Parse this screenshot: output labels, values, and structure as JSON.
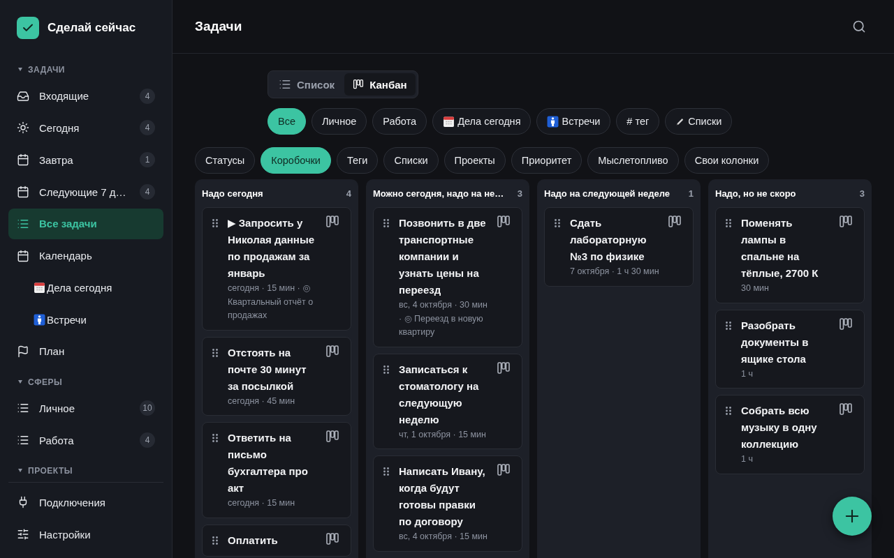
{
  "app": {
    "name": "Сделай сейчас"
  },
  "sidebar": {
    "sections": [
      {
        "title": "ЗАДАЧИ",
        "expanded": true,
        "items": [
          {
            "label": "Входящие",
            "kind": "inbox",
            "count": "4",
            "selected": false
          },
          {
            "label": "Сегодня",
            "kind": "sun",
            "count": "4",
            "selected": false
          },
          {
            "label": "Завтра",
            "kind": "calendar",
            "count": "1",
            "selected": false
          },
          {
            "label": "Следующие 7 д…",
            "kind": "calendar",
            "count": "4",
            "selected": false
          },
          {
            "label": "Все задачи",
            "kind": "list",
            "selected": true
          },
          {
            "label": "Календарь",
            "kind": "calendar",
            "selected": false,
            "children": [
              {
                "label": "Дела сегодня",
                "kind": "calendar-emoji",
                "selected": false
              },
              {
                "label": "Встречи",
                "kind": "person-emoji",
                "selected": false
              }
            ]
          },
          {
            "label": "План",
            "kind": "flag",
            "selected": false
          }
        ]
      },
      {
        "title": "СФЕРЫ",
        "expanded": true,
        "items": [
          {
            "label": "Личное",
            "kind": "list",
            "count": "10",
            "selected": false
          },
          {
            "label": "Работа",
            "kind": "list",
            "count": "4",
            "selected": false
          }
        ]
      },
      {
        "title": "ПРОЕКТЫ",
        "expanded": true
      }
    ],
    "footer": [
      {
        "label": "Подключения",
        "kind": "plug"
      },
      {
        "label": "Настройки",
        "kind": "sliders"
      }
    ]
  },
  "header": {
    "title": "Задачи"
  },
  "view_toggle": [
    {
      "label": "Список",
      "kind": "list",
      "selected": false
    },
    {
      "label": "Канбан",
      "kind": "kanban",
      "selected": true
    }
  ],
  "filters": [
    {
      "label": "Все",
      "kind": "text",
      "selected": true
    },
    {
      "label": "Личное",
      "kind": "text",
      "selected": false
    },
    {
      "label": "Работа",
      "kind": "text",
      "selected": false
    },
    {
      "label": "Дела сегодня",
      "kind": "calendar-emoji",
      "selected": false
    },
    {
      "label": "Встречи",
      "kind": "person-emoji",
      "selected": false
    },
    {
      "label": "# тег",
      "kind": "text",
      "selected": false
    },
    {
      "label": "Списки",
      "kind": "pencil",
      "selected": false
    }
  ],
  "groupings": [
    {
      "label": "Статусы",
      "selected": false
    },
    {
      "label": "Коробочки",
      "selected": true
    },
    {
      "label": "Теги",
      "selected": false
    },
    {
      "label": "Списки",
      "selected": false
    },
    {
      "label": "Проекты",
      "selected": false
    },
    {
      "label": "Приоритет",
      "selected": false
    },
    {
      "label": "Мыслетопливо",
      "selected": false
    },
    {
      "label": "Свои колонки",
      "selected": false
    }
  ],
  "columns": [
    {
      "title": "Надо сегодня",
      "count": "4",
      "cards": [
        {
          "title": "▶ Запросить у Николая данные по продажам за январь",
          "meta": "сегодня · 15 мин · ◎ Квартальный отчёт о продажах"
        },
        {
          "title": "Отстоять на почте 30 минут за посылкой",
          "meta": "сегодня · 45 мин"
        },
        {
          "title": "Ответить на письмо бухгалтера про акт",
          "meta": "сегодня · 15 мин"
        },
        {
          "title": "Оплатить"
        }
      ]
    },
    {
      "title": "Можно сегодня, надо на не…",
      "count": "3",
      "cards": [
        {
          "title": "Позвонить в две транспортные компании и узнать цены на переезд",
          "meta": "вс, 4 октября · 30 мин · ◎ Переезд в новую квартиру"
        },
        {
          "title": "Записаться к стоматологу на следующую неделю",
          "meta": "чт, 1 октября · 15 мин"
        },
        {
          "title": "Написать Ивану, когда будут готовы правки по договору",
          "meta": "вс, 4 октября · 15 мин"
        }
      ]
    },
    {
      "title": "Надо на следующей неделе",
      "count": "1",
      "cards": [
        {
          "title": "Сдать лабораторную №3 по физике",
          "meta": "7 октября · 1 ч 30 мин"
        }
      ]
    },
    {
      "title": "Надо, но не скоро",
      "count": "3",
      "cards": [
        {
          "title": "Поменять лампы в спальне на тёплые, 2700 К",
          "meta": "30 мин"
        },
        {
          "title": "Разобрать документы в ящике стола",
          "meta": "1 ч"
        },
        {
          "title": "Собрать всю музыку в одну коллекцию",
          "meta": "1 ч"
        }
      ]
    }
  ]
}
